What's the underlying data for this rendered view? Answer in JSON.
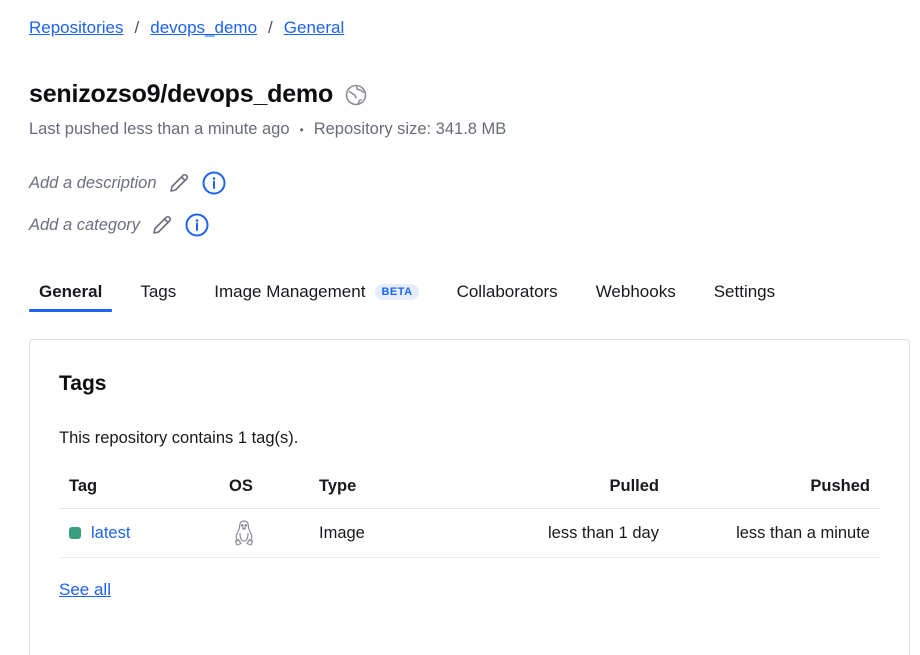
{
  "breadcrumb": {
    "items": [
      "Repositories",
      "devops_demo",
      "General"
    ],
    "separator": "/"
  },
  "repo": {
    "title": "senizozso9/devops_demo",
    "visibility_icon": "public-globe-icon",
    "last_pushed": "Last pushed less than a minute ago",
    "separator_dot": "•",
    "size": "Repository size: 341.8 MB",
    "description_placeholder": "Add a description",
    "category_placeholder": "Add a category"
  },
  "tabs": [
    {
      "label": "General",
      "active": true
    },
    {
      "label": "Tags"
    },
    {
      "label": "Image Management",
      "badge": "BETA"
    },
    {
      "label": "Collaborators"
    },
    {
      "label": "Webhooks"
    },
    {
      "label": "Settings"
    }
  ],
  "tags_card": {
    "title": "Tags",
    "summary": "This repository contains 1 tag(s).",
    "columns": [
      "Tag",
      "OS",
      "Type",
      "Pulled",
      "Pushed"
    ],
    "rows": [
      {
        "tag": "latest",
        "os_icon": "linux-tux-icon",
        "type": "Image",
        "pulled": "less than 1 day",
        "pushed": "less than a minute"
      }
    ],
    "see_all": "See all"
  },
  "colors": {
    "link": "#1d63ed",
    "status_active": "#3a9d7f",
    "muted_text": "#676c78"
  }
}
